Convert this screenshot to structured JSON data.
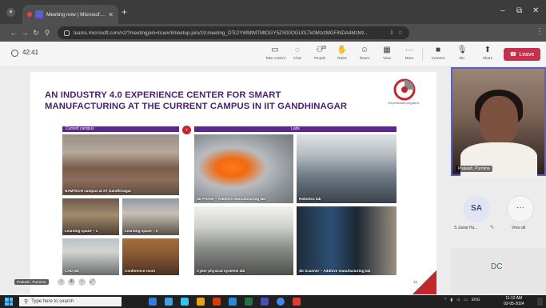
{
  "browser": {
    "tab_title": "Meeting now | Microsoft Te",
    "tab_close": "✕",
    "new_tab": "+",
    "url": "teams.microsoft.com/v2/?meetingjoin=true#/l/meetup-join/19:meeting_OTc2YWMtMTMtOGY5ZS00OGU0LTk0MzctMGFiNDA4MzMz...",
    "window_controls": [
      "–",
      "⧉",
      "✕"
    ]
  },
  "meeting": {
    "timer": "42:41",
    "controls": [
      {
        "label": "Take control",
        "glyph": "▭"
      },
      {
        "label": "Chat",
        "glyph": "◌"
      },
      {
        "label": "People",
        "glyph": "⚇",
        "count": "28"
      },
      {
        "label": "Raise",
        "glyph": "✋"
      },
      {
        "label": "React",
        "glyph": "☺"
      },
      {
        "label": "View",
        "glyph": "▦"
      },
      {
        "label": "More",
        "glyph": "···"
      },
      {
        "label": "Camera",
        "glyph": "■"
      },
      {
        "label": "Mic",
        "glyph": "🎙"
      },
      {
        "label": "Share",
        "glyph": "⬆"
      }
    ],
    "leave_label": "Leave"
  },
  "slide": {
    "title_line1": "AN INDUSTRY 4.0 EXPERIENCE CENTER FOR SMART",
    "title_line2": "MANUFACTURING AT THE CURRENT CAMPUS IN IIT GANDHINAGAR",
    "logo_caption": "Experiential programs",
    "header_campus": "Current campus",
    "header_labs": "Labs",
    "campus_photos": [
      "NAMTECH campus at IIT Gandhinagar",
      "Learning space – 1",
      "Learning space – 2",
      "CAD lab",
      "Conference room"
    ],
    "lab_photos": [
      "3D Printer – Additive manufacturing lab",
      "Robotics lab",
      "Cyber physical systems lab",
      "3D Scanner – Additive manufacturing lab"
    ],
    "page_number": "16"
  },
  "participants": {
    "self_name": "Prakash, Purnima",
    "sa_initials": "SA",
    "sa_name": "S Jawal Ha...",
    "more_label": "View all",
    "dc_initials": "DC"
  },
  "caption_chip": "Prakash, Purnima",
  "taskbar": {
    "search_placeholder": "Type here to search",
    "tray_text": "ENG",
    "time": "11:12 AM",
    "date": "02-05-2024"
  },
  "colors": {
    "teams_purple": "#5b5fc7",
    "slide_purple": "#4b1f6e",
    "leave_red": "#c4314b",
    "accent_red": "#c4262e"
  }
}
